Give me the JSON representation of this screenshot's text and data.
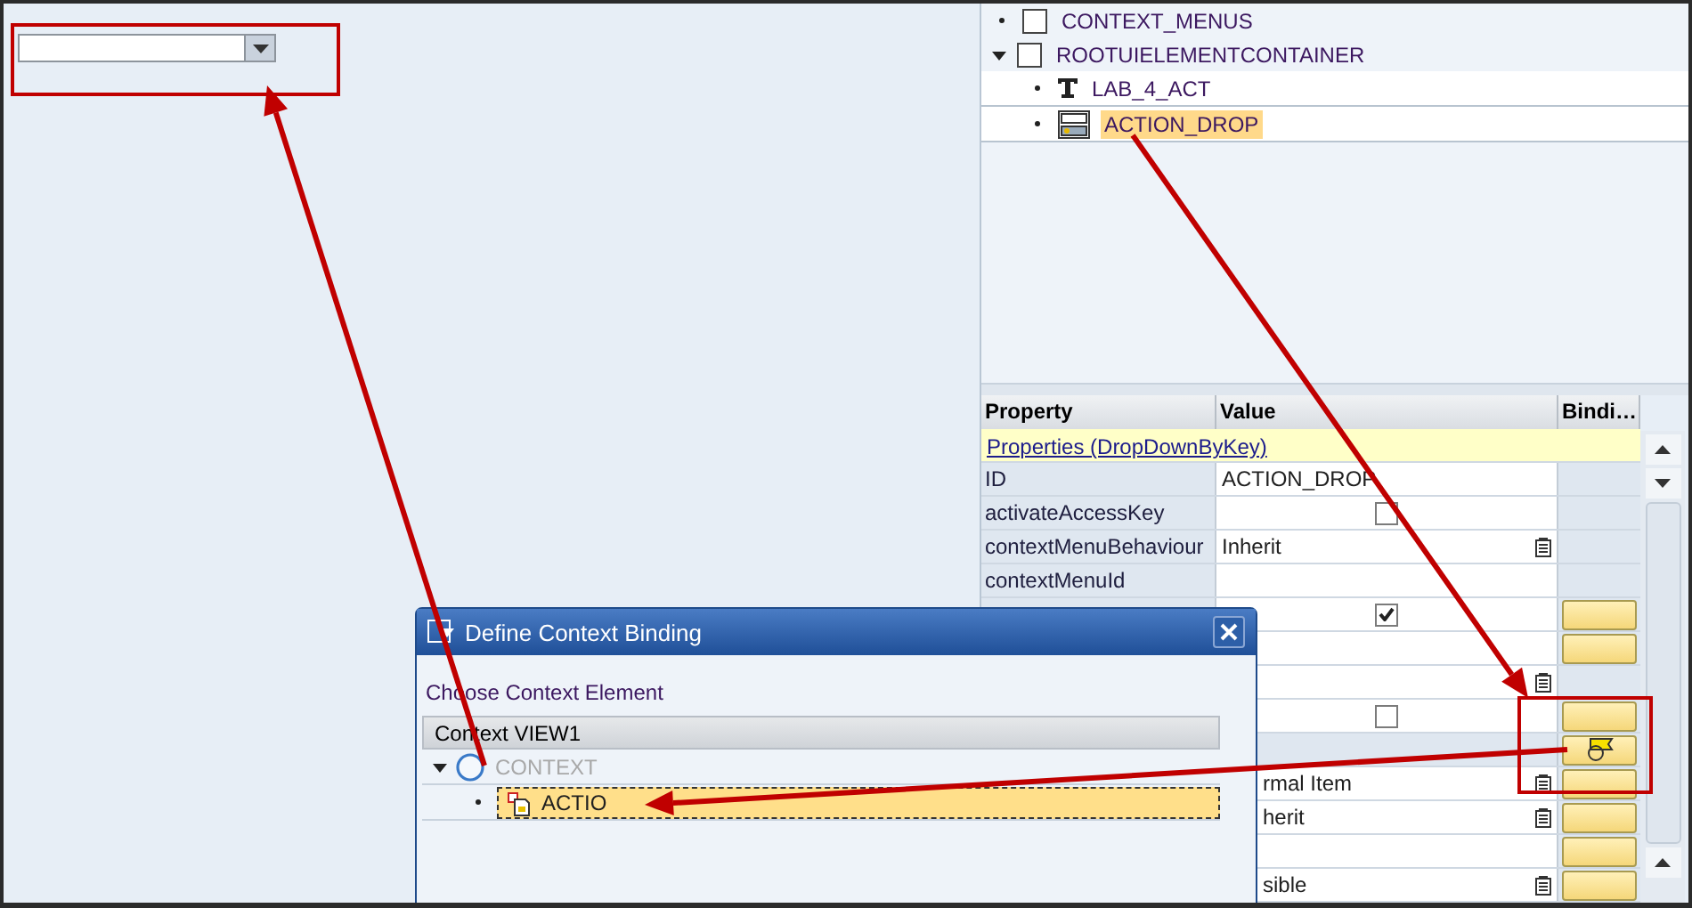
{
  "ui_tree": [
    {
      "label": "CONTEXT_MENUS",
      "kind": "box",
      "expanded": false,
      "selected": false
    },
    {
      "label": "ROOTUIELEMENTCONTAINER",
      "kind": "box",
      "expanded": true,
      "selected": false,
      "children": [
        {
          "label": "LAB_4_ACT",
          "kind": "label",
          "selected": false
        },
        {
          "label": "ACTION_DROP",
          "kind": "dropdown",
          "selected": true
        }
      ]
    }
  ],
  "properties": {
    "columns": [
      "Property",
      "Value",
      "Bindi…"
    ],
    "section": "Properties (DropDownByKey)",
    "rows": [
      {
        "property": "ID",
        "kind": "text",
        "value": "ACTION_DROP",
        "binding_button": false
      },
      {
        "property": "activateAccessKey",
        "kind": "checkbox",
        "checked": false,
        "binding_button": false
      },
      {
        "property": "contextMenuBehaviour",
        "kind": "dropdown",
        "value": "Inherit",
        "binding_button": false
      },
      {
        "property": "contextMenuId",
        "kind": "empty",
        "binding_button": false
      },
      {
        "kind": "checkbox",
        "checked": true,
        "binding_button": true
      },
      {
        "kind": "empty",
        "binding_button": true
      },
      {
        "kind": "dropdown",
        "binding_button": false
      },
      {
        "kind": "checkbox",
        "checked": false,
        "binding_button": true
      },
      {
        "kind": "empty",
        "binding_button": true,
        "bound": true
      },
      {
        "kind": "dropdown",
        "value": "rmal Item",
        "binding_button": true
      },
      {
        "kind": "dropdown",
        "value": "herit",
        "binding_button": true
      },
      {
        "kind": "empty",
        "binding_button": true
      },
      {
        "kind": "dropdown",
        "value": "sible",
        "binding_button": true
      }
    ]
  },
  "dialog": {
    "title": "Define Context Binding",
    "prompt": "Choose Context Element",
    "tree_header": "Context VIEW1",
    "tree": [
      {
        "label": "CONTEXT",
        "expanded": true,
        "disabled": true,
        "selected": false,
        "children": [
          {
            "label": "ACTIO",
            "disabled": false,
            "selected": true
          }
        ]
      }
    ]
  }
}
